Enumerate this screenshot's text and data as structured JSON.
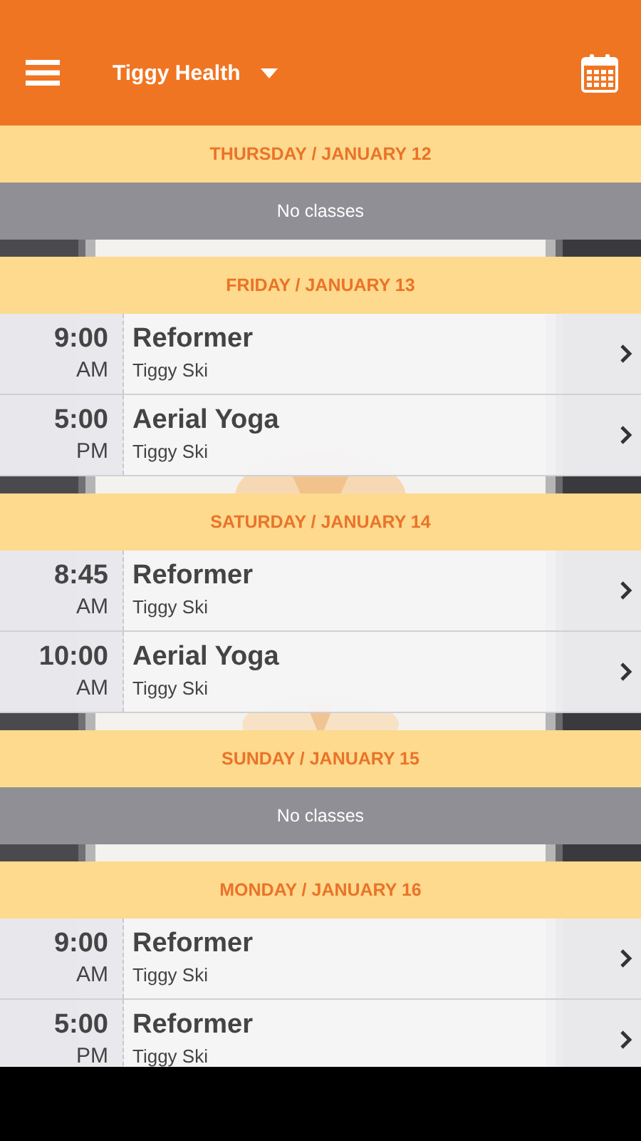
{
  "app_bar": {
    "title": "Tiggy Health"
  },
  "days": [
    {
      "title": "THURSDAY / JANUARY 12",
      "kind": "empty",
      "message": "No classes"
    },
    {
      "title": "FRIDAY / JANUARY 13",
      "kind": "classes",
      "classes": [
        {
          "time": "9:00",
          "meridiem": "AM",
          "name": "Reformer",
          "location": "Tiggy Ski"
        },
        {
          "time": "5:00",
          "meridiem": "PM",
          "name": "Aerial Yoga",
          "location": "Tiggy Ski"
        }
      ]
    },
    {
      "title": "SATURDAY / JANUARY 14",
      "kind": "classes",
      "classes": [
        {
          "time": "8:45",
          "meridiem": "AM",
          "name": "Reformer",
          "location": "Tiggy Ski"
        },
        {
          "time": "10:00",
          "meridiem": "AM",
          "name": "Aerial Yoga",
          "location": "Tiggy Ski"
        }
      ]
    },
    {
      "title": "SUNDAY / JANUARY 15",
      "kind": "empty",
      "message": "No classes"
    },
    {
      "title": "MONDAY / JANUARY 16",
      "kind": "classes",
      "classes": [
        {
          "time": "9:00",
          "meridiem": "AM",
          "name": "Reformer",
          "location": "Tiggy Ski"
        },
        {
          "time": "5:00",
          "meridiem": "PM",
          "name": "Reformer",
          "location": "Tiggy Ski"
        }
      ]
    }
  ]
}
